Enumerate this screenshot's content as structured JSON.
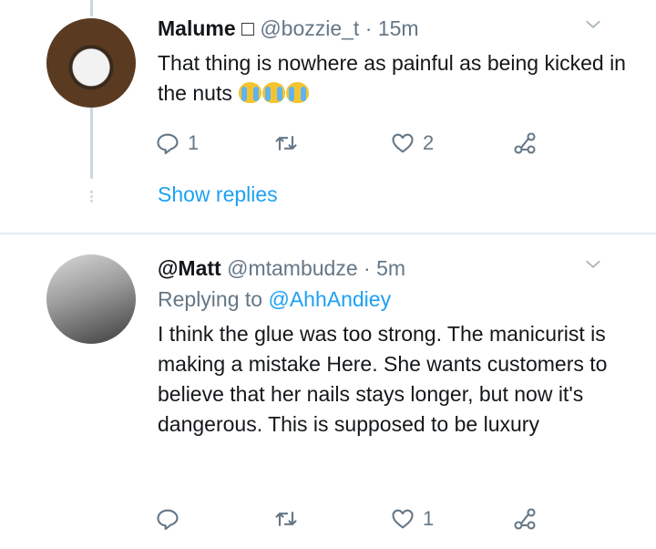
{
  "tweets": [
    {
      "display_name": "Malume □",
      "handle": "@bozzie_t",
      "separator": "·",
      "time": "15m",
      "text": "That thing is nowhere as painful as being kicked in the nuts",
      "emoji": [
        "crying-face",
        "crying-face",
        "crying-face"
      ],
      "reply_count": "1",
      "retweet_count": "",
      "like_count": "2",
      "show_replies": "Show replies"
    },
    {
      "display_name": "@Matt",
      "handle": "@mtambudze",
      "separator": "·",
      "time": "5m",
      "replying_to_prefix": "Replying to",
      "replying_to_handle": "@AhhAndiey",
      "text": "I think the glue was too strong. The manicurist is making  a mistake Here. She wants customers to believe that her nails stays longer, but now it's dangerous. This is supposed to be luxury",
      "reply_count": "",
      "retweet_count": "",
      "like_count": "1"
    }
  ],
  "colors": {
    "link": "#1da1f2",
    "muted": "#657786",
    "text": "#14171a",
    "divider": "#e6ecf0"
  },
  "icons": [
    "reply-icon",
    "retweet-icon",
    "like-icon",
    "share-icon",
    "chevron-down-icon"
  ]
}
